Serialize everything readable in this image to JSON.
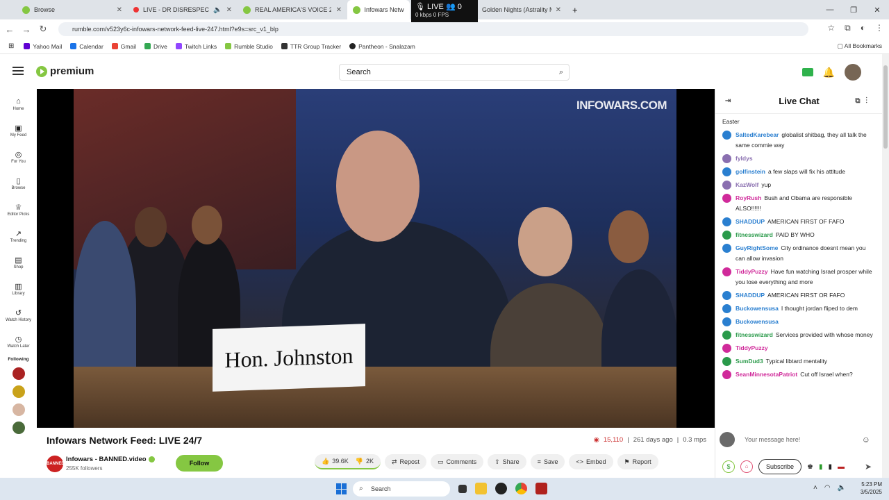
{
  "browser": {
    "tabs": [
      {
        "title": "Browse",
        "color": "#85c742"
      },
      {
        "title": "LIVE - DR DISRESPECT -",
        "color": "#e33"
      },
      {
        "title": "REAL AMERICA'S VOICE 24/",
        "color": "#85c742"
      },
      {
        "title": "Infowars Network F",
        "color": "#85c742",
        "active": true
      },
      {
        "title": "Golden Nights (Astrality M",
        "color": "#9a5"
      }
    ],
    "live_overlay": {
      "status": "LIVE",
      "viewers": "0",
      "stats": "0 kbps 0 FPS"
    },
    "url": "rumble.com/v523y6c-infowars-network-feed-live-247.html?e9s=src_v1_blp",
    "bookmarks": [
      {
        "label": "Yahoo Mail",
        "color": "#6001d2"
      },
      {
        "label": "Calendar",
        "color": "#1a73e8"
      },
      {
        "label": "Gmail",
        "color": "#ea4335"
      },
      {
        "label": "Drive",
        "color": "#34a853"
      },
      {
        "label": "Twitch Links",
        "color": "#9146ff"
      },
      {
        "label": "Rumble Studio",
        "color": "#85c742"
      },
      {
        "label": "TTR Group Tracker",
        "color": "#333333"
      },
      {
        "label": "Pantheon - Snalazam",
        "color": "#222222"
      }
    ],
    "all_bookmarks": "All Bookmarks"
  },
  "header": {
    "logo": "premium",
    "search_placeholder": "Search"
  },
  "sidebar": {
    "items": [
      {
        "label": "Home",
        "icon": "⌂"
      },
      {
        "label": "My Feed",
        "icon": "▣"
      },
      {
        "label": "For You",
        "icon": "◎"
      },
      {
        "label": "Browse",
        "icon": "▯"
      },
      {
        "label": "Editor Picks",
        "icon": "♕"
      },
      {
        "label": "Trending",
        "icon": "↗"
      },
      {
        "label": "Shop",
        "icon": "▤"
      },
      {
        "label": "Library",
        "icon": "▥"
      },
      {
        "label": "Watch History",
        "icon": "↺"
      },
      {
        "label": "Watch Later",
        "icon": "◷"
      }
    ],
    "following_label": "Following"
  },
  "video": {
    "watermark": "INFOWARS.COM",
    "nameplate": "Hon. Johnston",
    "title": "Infowars Network Feed: LIVE 24/7",
    "views": "15,110",
    "age": "261 days ago",
    "rate": "0.3 mps",
    "channel_name": "Infowars - BANNED.video",
    "followers": "255K followers",
    "follow_label": "Follow",
    "likes": "39.6K",
    "dislikes": "2K",
    "actions": [
      "Repost",
      "Comments",
      "Share",
      "Save",
      "Embed",
      "Report"
    ]
  },
  "chat": {
    "title": "Live Chat",
    "messages": [
      {
        "user": "",
        "text": "Easter",
        "color": "#222222"
      },
      {
        "user": "SaltedKarebear",
        "text": "globalist shitbag, they all talk the same commie way",
        "color": "#2a7fd0"
      },
      {
        "user": "fyldys",
        "text": "",
        "color": "#8a6fb0"
      },
      {
        "user": "golfinstein",
        "text": "a few slaps will fix his attitude",
        "color": "#2a7fd0"
      },
      {
        "user": "KazWolf",
        "text": "yup",
        "color": "#8a6fb0"
      },
      {
        "user": "RoyRush",
        "text": "Bush and Obama are responsible ALSO!!!!!!",
        "color": "#d02a9a"
      },
      {
        "user": "SHADDUP",
        "text": "AMERICAN FIRST OF FAFO",
        "color": "#2a7fd0"
      },
      {
        "user": "fitnesswizard",
        "text": "PAID BY WHO",
        "color": "#2a9a4a"
      },
      {
        "user": "GuyRightSome",
        "text": "City ordinance doesnt mean you can allow invasion",
        "color": "#2a7fd0"
      },
      {
        "user": "TiddyPuzzy",
        "text": "Have fun watching Israel prosper while you lose everything and more",
        "color": "#d02a9a"
      },
      {
        "user": "SHADDUP",
        "text": "AMERICAN FIRST OR FAFO",
        "color": "#2a7fd0"
      },
      {
        "user": "Buckowensusa",
        "text": "I thought jordan fliped to dem",
        "color": "#2a7fd0"
      },
      {
        "user": "Buckowensusa",
        "text": "",
        "color": "#2a7fd0"
      },
      {
        "user": "fitnesswizard",
        "text": "Services provided with whose money",
        "color": "#2a9a4a"
      },
      {
        "user": "TiddyPuzzy",
        "text": "",
        "color": "#d02a9a"
      },
      {
        "user": "SumDud3",
        "text": "Typical libtard mentality",
        "color": "#2a9a4a"
      },
      {
        "user": "SeanMinnesotaPatriot",
        "text": "Cut off Israel when?",
        "color": "#d02a9a"
      }
    ],
    "input_placeholder": "Your message here!",
    "subscribe_label": "Subscribe"
  },
  "taskbar": {
    "search_label": "Search",
    "time": "5:23 PM",
    "date": "3/5/2025"
  }
}
